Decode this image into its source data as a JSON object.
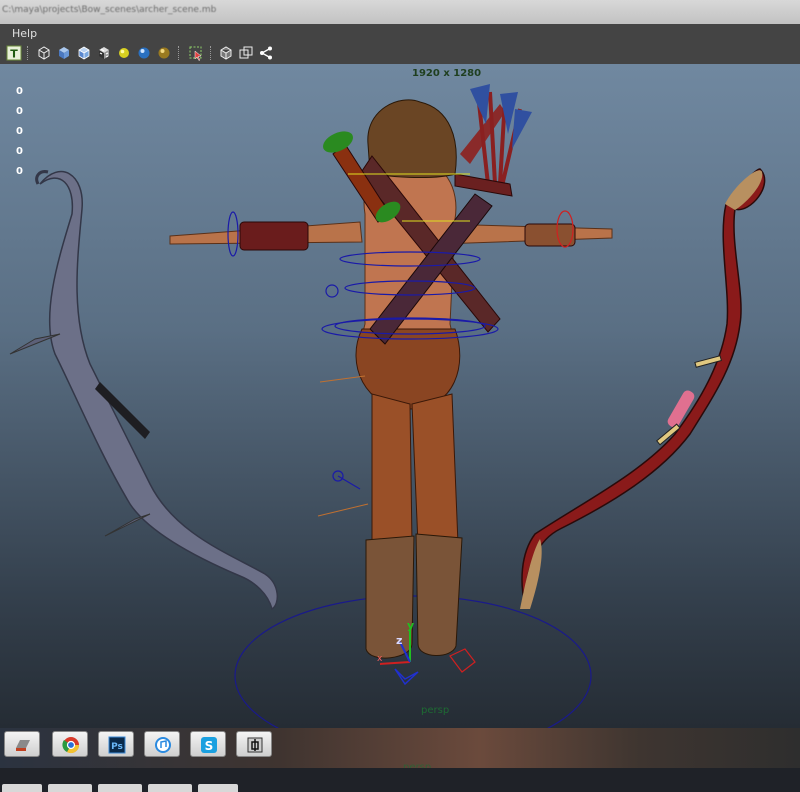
{
  "window": {
    "title": "C:\\maya\\projects\\Bow_scenes\\archer_scene.mb"
  },
  "menu": {
    "help": "Help"
  },
  "toolbar_icons": [
    "text-icon",
    "wire-cube-icon",
    "smooth-shade-cube-icon",
    "shaded-wire-cube-icon",
    "textured-cube-icon",
    "default-light-icon",
    "all-lights-icon",
    "shadow-light-icon",
    "select-tool-icon",
    "isolate-cube-icon",
    "xray-cube-icon",
    "connections-icon"
  ],
  "viewport": {
    "hud_values": [
      "0",
      "0",
      "0",
      "0",
      "0"
    ],
    "resolution": "1920 x 1280",
    "camera_label": "persp",
    "camera_label_ghost": "persp",
    "axis_y": "y",
    "axis_z": "z",
    "axis_x": "x"
  },
  "taskbar": {
    "buttons": [
      "maya-icon",
      "chrome-icon",
      "photoshop-icon",
      "itunes-icon",
      "skype-icon",
      "pinned-app-icon"
    ]
  },
  "colors": {
    "viewport_top": "#7088a0",
    "viewport_bottom": "#252c34",
    "hud_text": "#ffffff",
    "resolution_text": "#1f3f1f",
    "persp_text": "#1e6b33"
  }
}
